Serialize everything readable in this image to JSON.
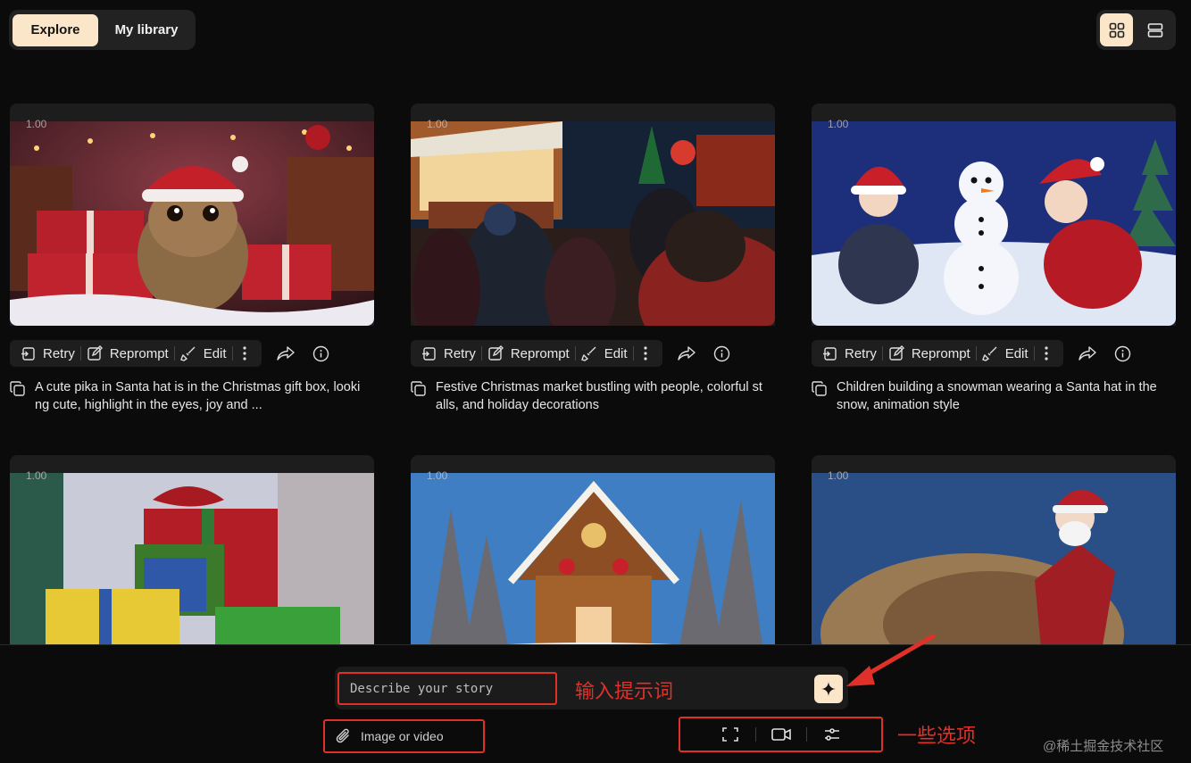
{
  "tabs": {
    "explore": "Explore",
    "library": "My library"
  },
  "view_modes": [
    "grid-view-icon",
    "list-view-icon"
  ],
  "card_actions": {
    "retry": "Retry",
    "reprompt": "Reprompt",
    "edit": "Edit"
  },
  "cards": [
    {
      "ratio": "1.00",
      "caption": "A cute pika in Santa hat is in the Christmas gift box, looki ng cute, highlight in the eyes, joy and ..."
    },
    {
      "ratio": "1.00",
      "caption": "Festive Christmas market bustling with people, colorful st alls, and holiday decorations"
    },
    {
      "ratio": "1.00",
      "caption": "Children building a snowman wearing a Santa hat in the snow, animation style"
    },
    {
      "ratio": "1.00",
      "caption": ""
    },
    {
      "ratio": "1.00",
      "caption": ""
    },
    {
      "ratio": "1.00",
      "caption": ""
    }
  ],
  "prompt": {
    "placeholder": "Describe your story",
    "annotation": "输入提示词"
  },
  "attach": {
    "label": "Image or video"
  },
  "options": {
    "annotation": "一些选项",
    "icons": [
      "aspect-ratio-icon",
      "video-camera-icon",
      "sliders-icon"
    ]
  },
  "watermark": "@稀土掘金技术社区",
  "colors": {
    "accent": "#fbe6c9",
    "annotation_red": "#e0302a",
    "background": "#0b0b0b"
  }
}
